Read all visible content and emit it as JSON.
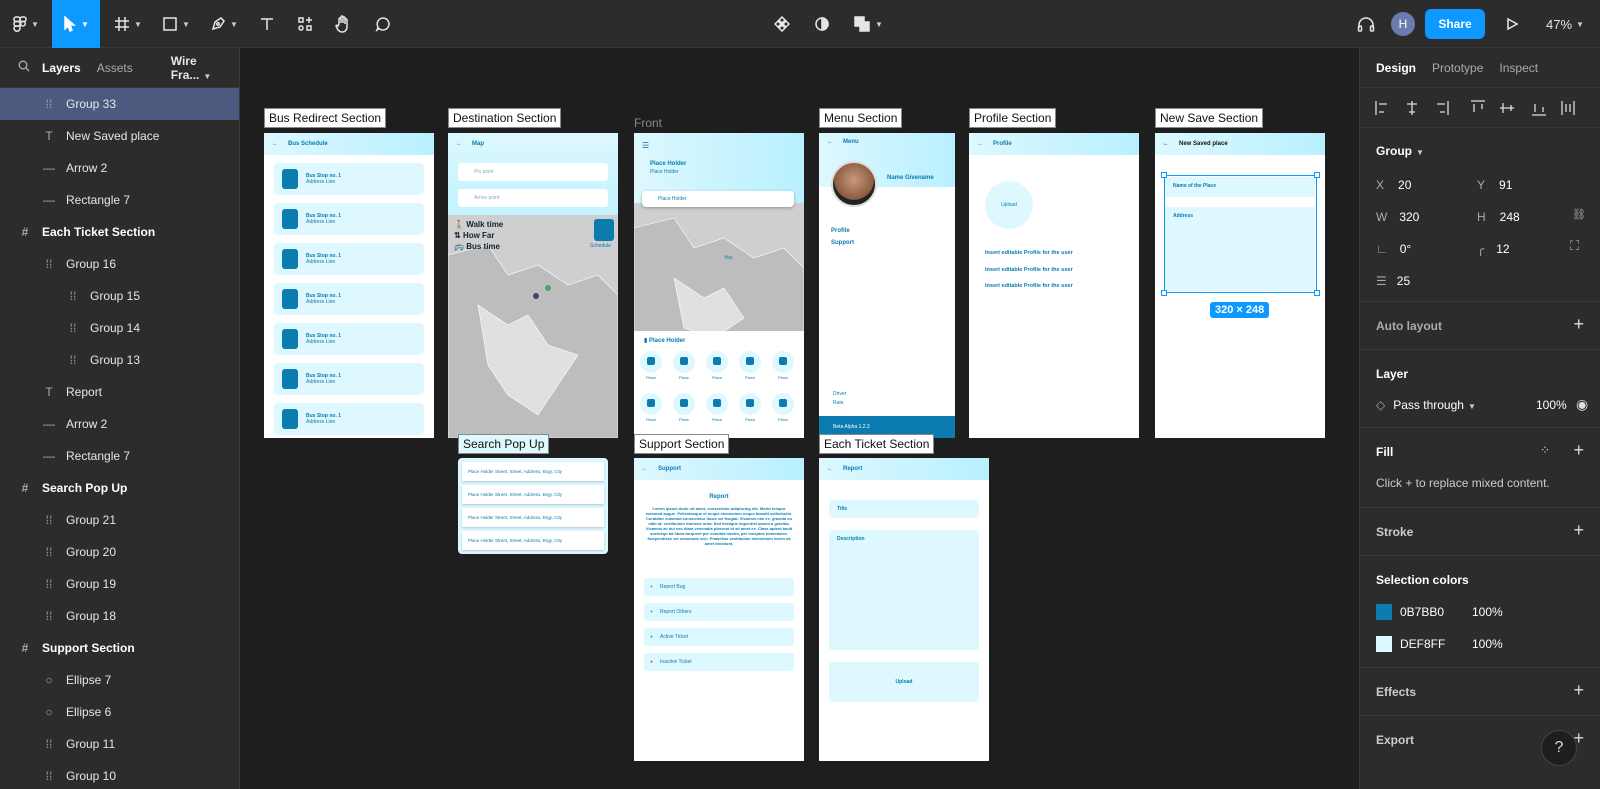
{
  "toolbar": {
    "share_label": "Share",
    "avatar_initial": "H",
    "zoom": "47%"
  },
  "left_panel": {
    "tabs": [
      "Layers",
      "Assets"
    ],
    "page_name": "Wire Fra...",
    "layers": [
      {
        "label": "Group 33",
        "type": "group",
        "indent": 1,
        "selected": true,
        "bold": false
      },
      {
        "label": "New Saved place",
        "type": "text",
        "indent": 1,
        "selected": false,
        "bold": false
      },
      {
        "label": "Arrow 2",
        "type": "line",
        "indent": 1,
        "selected": false,
        "bold": false
      },
      {
        "label": "Rectangle 7",
        "type": "line",
        "indent": 1,
        "selected": false,
        "bold": false
      },
      {
        "label": "Each Ticket Section",
        "type": "frame",
        "indent": 0,
        "selected": false,
        "bold": true
      },
      {
        "label": "Group 16",
        "type": "group",
        "indent": 1,
        "selected": false,
        "bold": false
      },
      {
        "label": "Group 15",
        "type": "group",
        "indent": 2,
        "selected": false,
        "bold": false
      },
      {
        "label": "Group 14",
        "type": "group",
        "indent": 2,
        "selected": false,
        "bold": false
      },
      {
        "label": "Group 13",
        "type": "group",
        "indent": 2,
        "selected": false,
        "bold": false
      },
      {
        "label": "Report",
        "type": "text",
        "indent": 1,
        "selected": false,
        "bold": false
      },
      {
        "label": "Arrow 2",
        "type": "line",
        "indent": 1,
        "selected": false,
        "bold": false
      },
      {
        "label": "Rectangle 7",
        "type": "line",
        "indent": 1,
        "selected": false,
        "bold": false
      },
      {
        "label": "Search Pop Up",
        "type": "frame",
        "indent": 0,
        "selected": false,
        "bold": true
      },
      {
        "label": "Group 21",
        "type": "group",
        "indent": 1,
        "selected": false,
        "bold": false
      },
      {
        "label": "Group 20",
        "type": "group",
        "indent": 1,
        "selected": false,
        "bold": false
      },
      {
        "label": "Group 19",
        "type": "group",
        "indent": 1,
        "selected": false,
        "bold": false
      },
      {
        "label": "Group 18",
        "type": "group",
        "indent": 1,
        "selected": false,
        "bold": false
      },
      {
        "label": "Support Section",
        "type": "frame",
        "indent": 0,
        "selected": false,
        "bold": true
      },
      {
        "label": "Ellipse 7",
        "type": "ellipse",
        "indent": 1,
        "selected": false,
        "bold": false
      },
      {
        "label": "Ellipse 6",
        "type": "ellipse",
        "indent": 1,
        "selected": false,
        "bold": false
      },
      {
        "label": "Group 11",
        "type": "group",
        "indent": 1,
        "selected": false,
        "bold": false
      },
      {
        "label": "Group 10",
        "type": "group",
        "indent": 1,
        "selected": false,
        "bold": false
      }
    ]
  },
  "canvas": {
    "frame_labels": {
      "bus": "Bus Redirect Section",
      "destination": "Destination Section",
      "front": "Front",
      "menu": "Menu Section",
      "profile": "Profile Section",
      "newsave": "New Save Section",
      "search": "Search Pop Up",
      "support": "Support Section",
      "ticket": "Each Ticket Section"
    },
    "selection_size": "320 × 248",
    "bus": {
      "header": "Bus Schedule",
      "stop_title": "Bus Stop no. 1",
      "stop_sub": "Address Line"
    },
    "destination": {
      "header": "Map",
      "from_placeholder": "Pin point",
      "to_placeholder": "Arrive point",
      "walk": "Walk time",
      "far": "How Far",
      "bustime": "Bus time",
      "schedule": "Schedule"
    },
    "front": {
      "title": "Place Holder",
      "sub": "Place Holder",
      "search": "Place Holder",
      "you": "You",
      "places_title": "Place Holder",
      "place": "Place"
    },
    "menu": {
      "header": "Menu",
      "name": "Name Givename",
      "profile": "Profile",
      "support": "Support",
      "driver": "Driver",
      "rate": "Rate",
      "version": "Beta Alpha 1.2.3"
    },
    "profile": {
      "header": "Profile",
      "upload": "Upload",
      "line": "Insert editable Profile for the user"
    },
    "newsave": {
      "header": "New Saved place",
      "name_field": "Name of the Place",
      "address_field": "Address"
    },
    "search": {
      "result": "Place Holder Street, Street, Address, Brgy, City"
    },
    "support": {
      "header": "Support",
      "title": "Report",
      "body": "Lorem ipsum dolor sit amet, consectetur adipiscing elit. Morbi tempor euismod augue. Pellentesque et neque elementum neque blandit sollicitudin. Curabitur euismod consectetur lacus vel feugiat. Vivamus nisi ex, gravida eu nibh at, vestibulum rhoncus urna. Sed tristique imperdiet ipsum a gravida. Vivamus ac dui nec diam venenatis placerat id sit amet ex. Class aptent taciti sociosqu ad litora torquent per conubia nostra, per inceptos himenaeos. Suspendisse vel commodo orci. Phasellus vestibulum elementum lorem sit amet tincidunt.",
      "items": [
        "Report Bug",
        "Report Others",
        "Active Ticket",
        "Inactive Ticket"
      ]
    },
    "ticket": {
      "header": "Report",
      "title_field": "Title",
      "desc_field": "Description",
      "upload": "Upload"
    }
  },
  "right_panel": {
    "tabs": [
      "Design",
      "Prototype",
      "Inspect"
    ],
    "group_label": "Group",
    "x": "20",
    "y": "91",
    "w": "320",
    "h": "248",
    "rotation": "0°",
    "radius": "12",
    "spacing": "25",
    "auto_layout": "Auto layout",
    "layer_title": "Layer",
    "blend": "Pass through",
    "opacity": "100%",
    "fill_title": "Fill",
    "fill_hint": "Click + to replace mixed content.",
    "stroke_title": "Stroke",
    "selection_colors_title": "Selection colors",
    "colors": [
      {
        "hex": "0B7BB0",
        "opacity": "100%",
        "swatch": "#0b7bb0"
      },
      {
        "hex": "DEF8FF",
        "opacity": "100%",
        "swatch": "#def8ff"
      }
    ],
    "effects_title": "Effects",
    "export_title": "Export"
  }
}
